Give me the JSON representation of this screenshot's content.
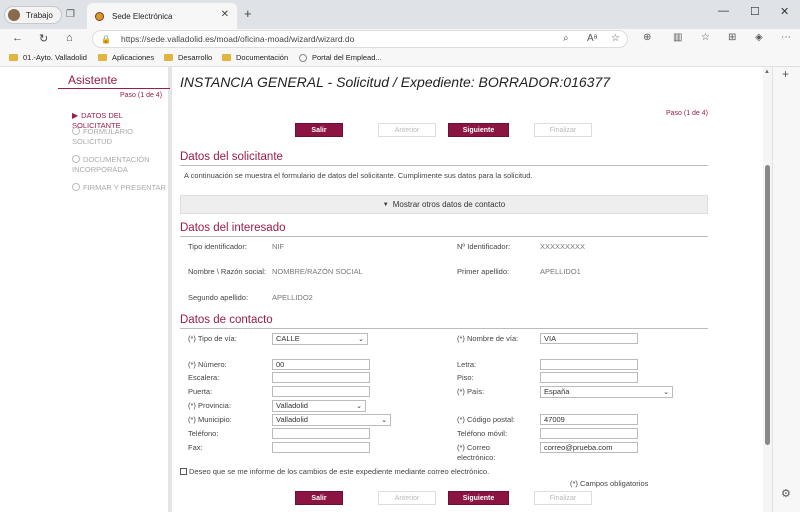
{
  "browser": {
    "profile_label": "Trabajo",
    "tab_title": "Sede Electrónica",
    "url": "https://sede.valladolid.es/moad/oficina-moad/wizard/wizard.do",
    "bookmarks": [
      "01.-Ayto. Valladolid",
      "Aplicaciones",
      "Desarrollo",
      "Documentación",
      "Portal del Emplead..."
    ]
  },
  "sidebar": {
    "title": "Asistente",
    "paso": "Paso (1 de 4)",
    "steps": [
      {
        "label": "DATOS DEL SOLICITANTE",
        "active": true
      },
      {
        "label": "FORMULARIO SOLICITUD",
        "active": false
      },
      {
        "label": "DOCUMENTACIÓN INCORPORADA",
        "active": false
      },
      {
        "label": "FIRMAR Y PRESENTAR",
        "active": false
      }
    ]
  },
  "main": {
    "title": "INSTANCIA GENERAL - Solicitud / Expediente: BORRADOR:016377",
    "paso": "Paso (1 de 4)",
    "buttons": {
      "salir": "Salir",
      "anterior": "Anterior",
      "siguiente": "Siguiente",
      "finalizar": "Finalizar"
    },
    "solicitante": {
      "heading": "Datos del solicitante",
      "intro": "A continuación se muestra el formulario de datos del solicitante. Cumplimente sus datos para la solicitud.",
      "toggle": "Mostrar otros datos de contacto"
    },
    "interesado": {
      "heading": "Datos del interesado",
      "tipo_label": "Tipo identificador:",
      "tipo_value": "NIF",
      "nid_label": "Nº Identificador:",
      "nid_value": "XXXXXXXXX",
      "nombre_label": "Nombre \\ Razón social:",
      "nombre_value": "NOMBRE/RAZÓN SOCIAL",
      "ap1_label": "Primer apellido:",
      "ap1_value": "APELLIDO1",
      "ap2_label": "Segundo apellido:",
      "ap2_value": "APELLIDO2"
    },
    "contacto": {
      "heading": "Datos de contacto",
      "tipo_via_label": "(*) Tipo de vía:",
      "tipo_via_value": "CALLE",
      "nombre_via_label": "(*) Nombre de vía:",
      "nombre_via_value": "VIA",
      "numero_label": "(*) Número:",
      "numero_value": "00",
      "letra_label": "Letra:",
      "escalera_label": "Escalera:",
      "piso_label": "Piso:",
      "puerta_label": "Puerta:",
      "pais_label": "(*) País:",
      "pais_value": "España",
      "provincia_label": "(*) Provincia:",
      "provincia_value": "Valladolid",
      "municipio_label": "(*) Municipio:",
      "municipio_value": "Valladolid",
      "cp_label": "(*) Código postal:",
      "cp_value": "47009",
      "telefono_label": "Teléfono:",
      "movil_label": "Teléfono móvil:",
      "fax_label": "Fax:",
      "correo_label": "(*) Correo electrónico:",
      "correo_value": "correo@prueba.com"
    },
    "checkbox_label": "Deseo que se me informe de los cambios de este expediente mediante correo electrónico.",
    "obligatorios": "(*) Campos obligatorios"
  }
}
